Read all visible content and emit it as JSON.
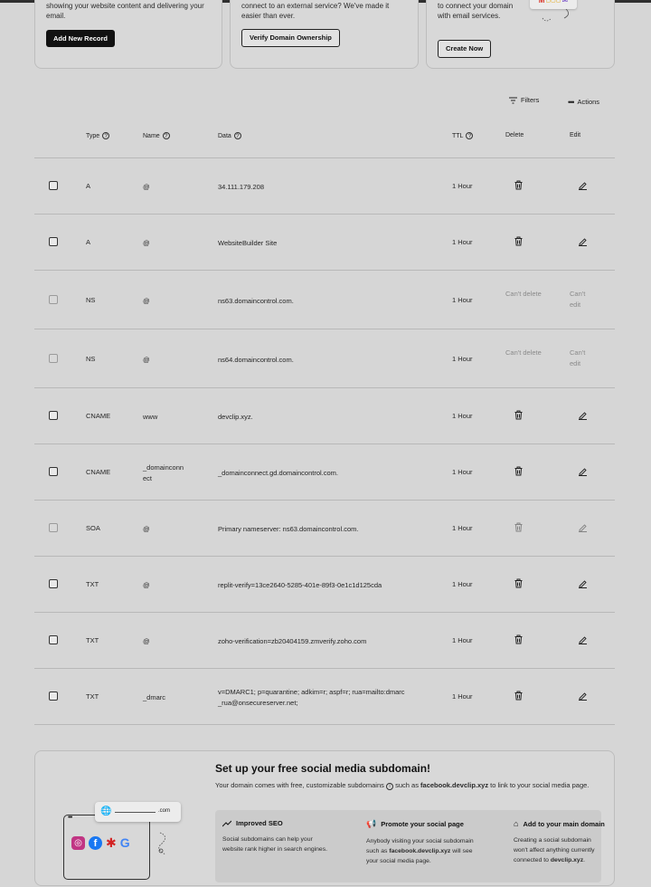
{
  "cards": [
    {
      "text": "showing your website content and delivering your email.",
      "button": "Add New Record"
    },
    {
      "text": "connect to an external service? We've made it easier than ever.",
      "button": "Verify Domain Ownership"
    },
    {
      "text": "to connect your domain with email services.",
      "button": "Create Now"
    }
  ],
  "toolbar": {
    "filters": "Filters",
    "actions": "Actions"
  },
  "table": {
    "headers": {
      "type": "Type",
      "name": "Name",
      "data": "Data",
      "ttl": "TTL",
      "delete": "Delete",
      "edit": "Edit"
    },
    "rows": [
      {
        "type": "A",
        "name": "@",
        "data": "34.111.179.208",
        "ttl": "1 Hour",
        "editable": true
      },
      {
        "type": "A",
        "name": "@",
        "data": "WebsiteBuilder Site",
        "ttl": "1 Hour",
        "editable": true
      },
      {
        "type": "NS",
        "name": "@",
        "data": "ns63.domaincontrol.com.",
        "ttl": "1 Hour",
        "editable": false,
        "cant_delete": "Can't delete",
        "cant_edit": "Can't edit"
      },
      {
        "type": "NS",
        "name": "@",
        "data": "ns64.domaincontrol.com.",
        "ttl": "1 Hour",
        "editable": false,
        "cant_delete": "Can't delete",
        "cant_edit": "Can't edit"
      },
      {
        "type": "CNAME",
        "name": "www",
        "data": "devclip.xyz.",
        "ttl": "1 Hour",
        "editable": true
      },
      {
        "type": "CNAME",
        "name": "_domainconn ect",
        "data": "_domainconnect.gd.domaincontrol.com.",
        "ttl": "1 Hour",
        "editable": true
      },
      {
        "type": "SOA",
        "name": "@",
        "data": "Primary nameserver: ns63.domaincontrol.com.",
        "ttl": "1 Hour",
        "editable": "dim"
      },
      {
        "type": "TXT",
        "name": "@",
        "data": "replit-verify=13ce2640-5285-401e-89f3-0e1c1d125cda",
        "ttl": "1 Hour",
        "editable": true
      },
      {
        "type": "TXT",
        "name": "@",
        "data": "zoho-verification=zb20404159.zmverify.zoho.com",
        "ttl": "1 Hour",
        "editable": true
      },
      {
        "type": "TXT",
        "name": "_dmarc",
        "data": "v=DMARC1; p=quarantine; adkim=r; aspf=r; rua=mailto:dmarc _rua@onsecureserver.net;",
        "ttl": "1 Hour",
        "editable": true
      }
    ]
  },
  "promo": {
    "title": "Set up your free social media subdomain!",
    "sub_1": "Your domain comes with free, customizable subdomains",
    "sub_2": "such as",
    "sub_bold": "facebook.devclip.xyz",
    "sub_3": "to link to your social media page.",
    "illus_domain": ".com",
    "features": [
      {
        "title": "Improved SEO",
        "desc": "Social subdomains can help your website rank higher in search engines."
      },
      {
        "title": "Promote your social page",
        "desc_1": "Anybody visiting your social subdomain such as",
        "desc_bold": "facebook.devclip.xyz",
        "desc_2": "will see your social media page."
      },
      {
        "title": "Add to your main domain",
        "desc_1": "Creating a social subdomain won't affect anything currently connected to",
        "desc_bold": "devclip.xyz",
        "desc_2": "."
      }
    ]
  }
}
